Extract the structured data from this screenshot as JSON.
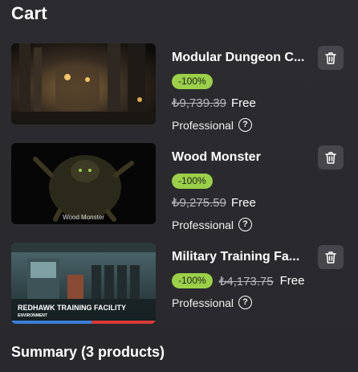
{
  "cart": {
    "title": "Cart",
    "items": [
      {
        "name": "Modular Dungeon C...",
        "discount": "-100%",
        "old_price": "₺9,739.39",
        "price": "Free",
        "license": "Professional",
        "help_icon": "help-circle-icon",
        "remove_icon": "trash-icon"
      },
      {
        "name": "Wood Monster",
        "discount": "-100%",
        "old_price": "₺9,275.59",
        "price": "Free",
        "license": "Professional",
        "thumb_caption": "Wood Monster",
        "help_icon": "help-circle-icon",
        "remove_icon": "trash-icon"
      },
      {
        "name": "Military Training Fa...",
        "discount": "-100%",
        "old_price": "₺4,173.75",
        "price": "Free",
        "license": "Professional",
        "thumb_caption": "REDHAWK TRAINING FACILITY",
        "thumb_subcaption": "ENVIRONMENT",
        "help_icon": "help-circle-icon",
        "remove_icon": "trash-icon"
      }
    ]
  },
  "summary": {
    "title": "Summary (3 products)"
  },
  "colors": {
    "background": "#2b2b2f",
    "discount_badge": "#9bd048",
    "button_bg": "#46464b",
    "old_price": "#b8b8bc"
  }
}
